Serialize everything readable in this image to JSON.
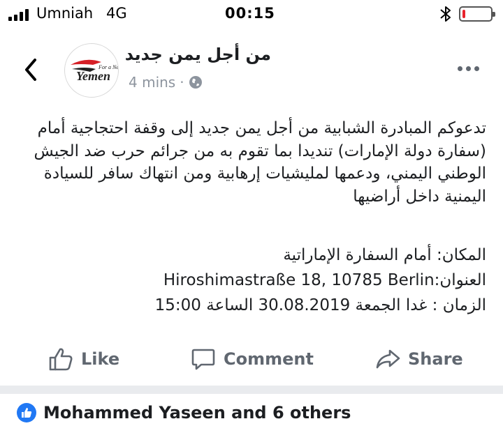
{
  "status_bar": {
    "carrier": "Umniah",
    "network": "4G",
    "time": "00:15",
    "battery_level": 0.1,
    "colors": {
      "battery_low": "#e8232c"
    }
  },
  "header": {
    "back_icon": "chevron-left-icon",
    "avatar_logo_text": [
      "For a New",
      "Yemen"
    ],
    "page_name": "من أجل يمن جديد",
    "time_ago": "4 mins",
    "separator": "·",
    "privacy_icon": "globe-icon",
    "more_icon": "more-horizontal-icon"
  },
  "post": {
    "body": "تدعوكم المبادرة الشبابية من أجل يمن جديد إلى وقفة احتجاجية أمام (سفارة دولة الإمارات) تنديدا بما تقوم به من جرائم حرب ضد الجيش الوطني اليمني، ودعمها لمليشيات إرهابية  ومن انتهاك سافر  للسيادة اليمنية داخل أراضيها",
    "place": "المكان: أمام السفارة الإماراتية",
    "address_label": "العنوان:",
    "address_value": "Hiroshimastraße 18, 10785 Berlin",
    "time_label": "الزمان : غدا الجمعة",
    "date_value": "30.08.2019",
    "hour_label": "الساعة",
    "hour_value": "15:00"
  },
  "actions": {
    "like_label": "Like",
    "comment_label": "Comment",
    "share_label": "Share"
  },
  "reactions": {
    "text": "Mohammed Yaseen and 6 others",
    "colors": {
      "like_blue": "#2078f4"
    }
  }
}
